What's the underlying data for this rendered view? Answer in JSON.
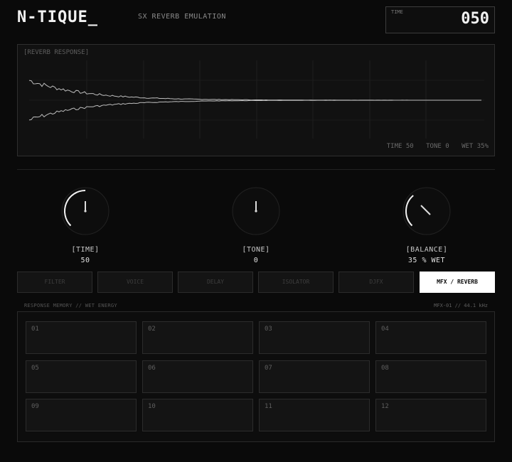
{
  "header": {
    "brand": "N-TIQUE_",
    "subtitle": "SX REVERB EMULATION",
    "time_label": "TIME",
    "time_value": "050"
  },
  "response": {
    "title": "[REVERB RESPONSE]",
    "readout": [
      "TIME 50",
      "TONE 0",
      "WET 35%"
    ]
  },
  "knobs": [
    {
      "label": "[TIME]",
      "value": "50",
      "level": 0.5
    },
    {
      "label": "[TONE]",
      "value": "0",
      "level": 0.0
    },
    {
      "label": "[BALANCE]",
      "value": "35 % WET",
      "level": 0.35
    }
  ],
  "tabs": [
    "FILTER",
    "VOICE",
    "DELAY",
    "ISOLATOR",
    "DJFX",
    "MFX / REVERB"
  ],
  "active_tab": 5,
  "memory": {
    "title": "RESPONSE MEMORY // WET ENERGY",
    "meta": "MFX-01 // 44.1 kHz",
    "slots": [
      "01",
      "02",
      "03",
      "04",
      "05",
      "06",
      "07",
      "08",
      "09",
      "10",
      "11",
      "12"
    ]
  },
  "colors": {
    "background": "#0a0a0a",
    "accent": "#ffffff",
    "panel": "#111111"
  }
}
